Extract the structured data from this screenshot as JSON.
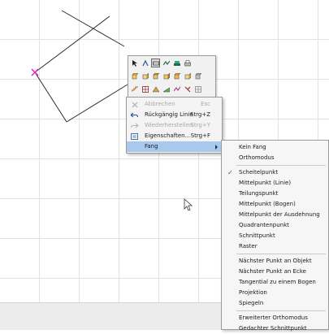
{
  "colors": {
    "canvas_bg": "#ffffff",
    "grid": "#e2e2e2",
    "line": "#2b2b2b",
    "cursor_marker": "#e31fc9",
    "menu_highlight": "#a8c8ec",
    "disabled_text": "#a8a8a8"
  },
  "toolbar": {
    "rows": [
      [
        "pointer-icon",
        "line-tool-icon",
        "wall-tool-icon",
        "snap-tool-icon",
        "layer-tool-icon",
        "print-icon"
      ],
      [
        "cube-1-icon",
        "cube-2-icon",
        "cube-3-icon",
        "cube-4-icon",
        "cube-5-icon",
        "cube-6-icon",
        "cube-7-icon"
      ],
      [
        "stairs-icon",
        "table-icon",
        "roof-icon",
        "slope-icon",
        "dimension-icon",
        "trim-icon",
        "grid-tool-icon"
      ]
    ]
  },
  "context_menu": {
    "items": [
      {
        "label": "Abbrechen",
        "shortcut": "Esc",
        "icon": "cancel-icon",
        "disabled": true
      },
      {
        "label": "Rückgängig Linie",
        "shortcut": "Strg+Z",
        "icon": "undo-icon",
        "disabled": false
      },
      {
        "label": "Wiederherstellen",
        "shortcut": "Strg+Y",
        "icon": "redo-icon",
        "disabled": true
      },
      {
        "label": "Eigenschaften...",
        "shortcut": "Strg+F",
        "icon": "properties-icon",
        "disabled": false
      },
      {
        "label": "Fang",
        "shortcut": "",
        "icon": "",
        "disabled": false,
        "highlight": true,
        "submenu": true
      }
    ]
  },
  "submenu": {
    "items": [
      {
        "label": "Kein Fang",
        "checked": false
      },
      {
        "label": "Orthomodus",
        "checked": false
      },
      {
        "separator": true
      },
      {
        "label": "Scheitelpunkt",
        "checked": true
      },
      {
        "label": "Mittelpunkt (Linie)",
        "checked": false
      },
      {
        "label": "Teilungspunkt",
        "checked": false
      },
      {
        "label": "Mittelpunkt (Bogen)",
        "checked": false
      },
      {
        "label": "Mittelpunkt der Ausdehnung",
        "checked": false
      },
      {
        "label": "Quadrantenpunkt",
        "checked": false
      },
      {
        "label": "Schnittpunkt",
        "checked": false
      },
      {
        "label": "Raster",
        "checked": false
      },
      {
        "separator": true
      },
      {
        "label": "Nächster Punkt an Objekt",
        "checked": false
      },
      {
        "label": "Nächster Punkt an Ecke",
        "checked": false
      },
      {
        "label": "Tangential zu einem Bogen",
        "checked": false
      },
      {
        "label": "Projektion",
        "checked": false
      },
      {
        "label": "Spiegeln",
        "checked": false
      },
      {
        "separator": true
      },
      {
        "label": "Erweiterter Orthomodus",
        "checked": false
      },
      {
        "label": "Gedachter Schnittpunkt",
        "checked": false
      }
    ]
  }
}
